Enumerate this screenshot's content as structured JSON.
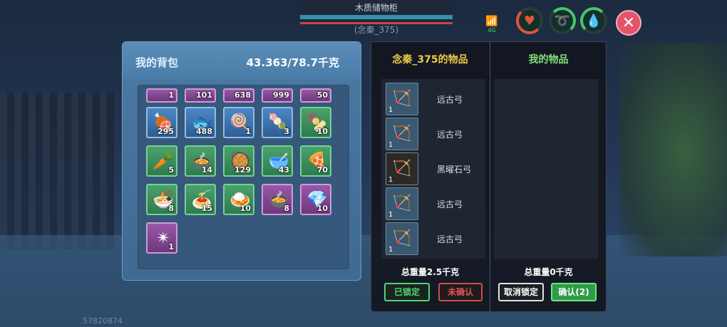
{
  "hud": {
    "location_title": "木质储物柜",
    "player_label": "(念秦_375)",
    "signal_icon": "signal-icon",
    "signal_text": "4G",
    "stats": [
      {
        "name": "health-ring",
        "icon": "heart-icon",
        "glyph": "♥"
      },
      {
        "name": "hunger-ring",
        "icon": "food-icon",
        "glyph": "➰"
      },
      {
        "name": "water-ring",
        "icon": "water-drop-icon",
        "glyph": "💧"
      }
    ],
    "close_glyph": "✕"
  },
  "backpack": {
    "title": "我的背包",
    "weight": "43.363/78.7千克",
    "slots": [
      {
        "row": 0,
        "col": 0,
        "rarity": "purple",
        "count": "1",
        "icon": "item-icon",
        "glyph": "",
        "half": true
      },
      {
        "row": 0,
        "col": 1,
        "rarity": "purple",
        "count": "101",
        "icon": "item-icon",
        "glyph": "",
        "half": true
      },
      {
        "row": 0,
        "col": 2,
        "rarity": "purple",
        "count": "638",
        "icon": "item-icon",
        "glyph": "",
        "half": true
      },
      {
        "row": 0,
        "col": 3,
        "rarity": "purple",
        "count": "999",
        "icon": "item-icon",
        "glyph": "",
        "half": true
      },
      {
        "row": 0,
        "col": 4,
        "rarity": "purple",
        "count": "50",
        "icon": "item-icon",
        "glyph": "",
        "half": true
      },
      {
        "row": 1,
        "col": 0,
        "rarity": "blue",
        "count": "295",
        "icon": "meat-icon",
        "glyph": "🍖"
      },
      {
        "row": 1,
        "col": 1,
        "rarity": "blue",
        "count": "488",
        "icon": "fish-dish-icon",
        "glyph": "🐟"
      },
      {
        "row": 1,
        "col": 2,
        "rarity": "blue",
        "count": "1",
        "icon": "lollipop-icon",
        "glyph": "🍭"
      },
      {
        "row": 1,
        "col": 3,
        "rarity": "blue",
        "count": "3",
        "icon": "candied-haws-icon",
        "glyph": "🍡"
      },
      {
        "row": 1,
        "col": 4,
        "rarity": "green",
        "count": "10",
        "icon": "skewer-icon",
        "glyph": "🍢"
      },
      {
        "row": 2,
        "col": 0,
        "rarity": "green",
        "count": "5",
        "icon": "radish-icon",
        "glyph": "🥕"
      },
      {
        "row": 2,
        "col": 1,
        "rarity": "green",
        "count": "14",
        "icon": "stew-icon",
        "glyph": "🍲"
      },
      {
        "row": 2,
        "col": 2,
        "rarity": "green",
        "count": "129",
        "icon": "stir-fry-icon",
        "glyph": "🥘"
      },
      {
        "row": 2,
        "col": 3,
        "rarity": "green",
        "count": "43",
        "icon": "soup-icon",
        "glyph": "🥣"
      },
      {
        "row": 2,
        "col": 4,
        "rarity": "green",
        "count": "70",
        "icon": "pizza-icon",
        "glyph": "🍕"
      },
      {
        "row": 3,
        "col": 0,
        "rarity": "green",
        "count": "8",
        "icon": "dumpling-bowl-icon",
        "glyph": "🍜"
      },
      {
        "row": 3,
        "col": 1,
        "rarity": "green",
        "count": "15",
        "icon": "noodle-bowl-icon",
        "glyph": "🍝"
      },
      {
        "row": 3,
        "col": 2,
        "rarity": "green",
        "count": "10",
        "icon": "bowl-icon",
        "glyph": "🍛"
      },
      {
        "row": 3,
        "col": 3,
        "rarity": "purple",
        "count": "8",
        "icon": "hotpot-icon",
        "glyph": "🍲"
      },
      {
        "row": 3,
        "col": 4,
        "rarity": "purple",
        "count": "10",
        "icon": "crystal-icon",
        "glyph": "💎"
      },
      {
        "row": 4,
        "col": 0,
        "rarity": "purple",
        "count": "1",
        "icon": "badge-icon",
        "glyph": "✴"
      }
    ]
  },
  "trade": {
    "other_title": "念秦_375的物品",
    "my_title": "我的物品",
    "other_items": [
      {
        "name": "远古弓",
        "count": "1",
        "icon": "bow-icon",
        "glyph": "🏹",
        "dark": false
      },
      {
        "name": "远古弓",
        "count": "1",
        "icon": "bow-icon",
        "glyph": "🏹",
        "dark": false
      },
      {
        "name": "黑曜石弓",
        "count": "1",
        "icon": "obsidian-bow-icon",
        "glyph": "🏹",
        "dark": true
      },
      {
        "name": "远古弓",
        "count": "1",
        "icon": "bow-icon",
        "glyph": "🏹",
        "dark": false
      },
      {
        "name": "远古弓",
        "count": "1",
        "icon": "bow-icon",
        "glyph": "🏹",
        "dark": false
      }
    ],
    "other_weight": "总重量2.5千克",
    "my_weight": "总重量0千克",
    "btn_locked": "已锁定",
    "btn_unconfirmed": "未确认",
    "btn_cancel_lock": "取消锁定",
    "btn_confirm": "确认(2)"
  },
  "uid": "57820874"
}
